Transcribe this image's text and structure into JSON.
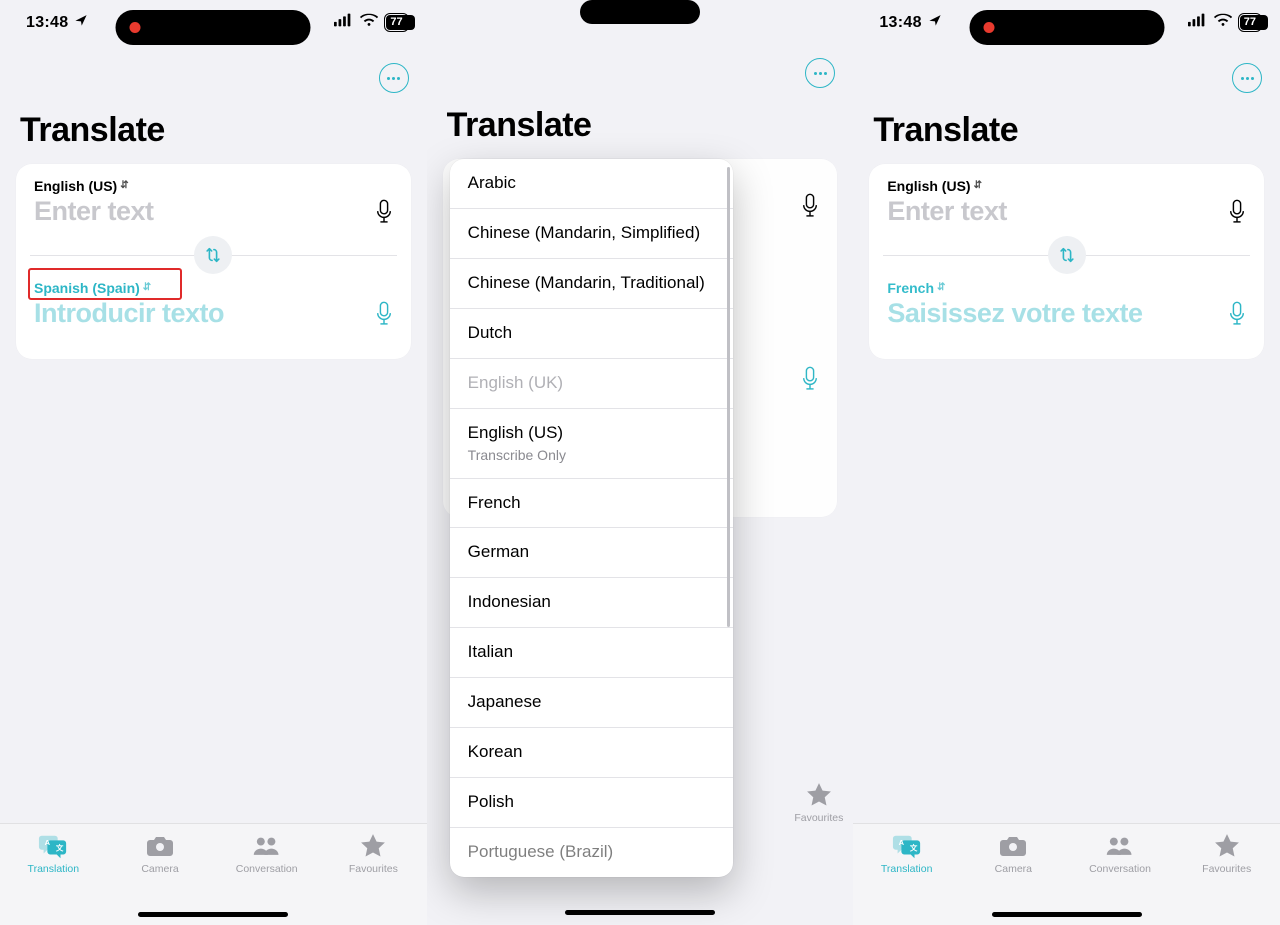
{
  "status": {
    "time": "13:48",
    "battery": "77"
  },
  "title": "Translate",
  "source": {
    "label": "English (US)",
    "placeholder": "Enter text"
  },
  "p1": {
    "target_label": "Spanish (Spain)",
    "target_placeholder": "Introducir texto"
  },
  "p3": {
    "target_label": "French",
    "target_placeholder": "Saisissez votre texte"
  },
  "tabs": {
    "translation": "Translation",
    "camera": "Camera",
    "conversation": "Conversation",
    "favourites": "Favourites"
  },
  "languages": {
    "i0": "Arabic",
    "i1": "Chinese (Mandarin, Simplified)",
    "i2": "Chinese (Mandarin, Traditional)",
    "i3": "Dutch",
    "i4": "English (UK)",
    "i5": "English (US)",
    "i5_sub": "Transcribe Only",
    "i6": "French",
    "i7": "German",
    "i8": "Indonesian",
    "i9": "Italian",
    "i10": "Japanese",
    "i11": "Korean",
    "i12": "Polish",
    "i13": "Portuguese (Brazil)"
  }
}
